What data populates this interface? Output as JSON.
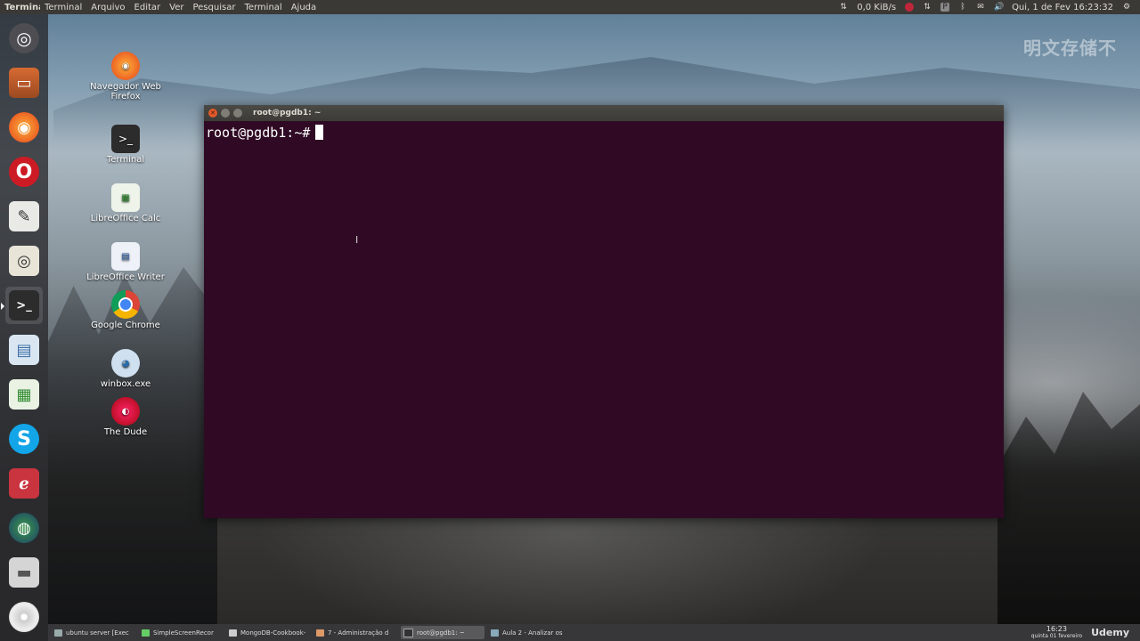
{
  "top_panel": {
    "app_name": "Terminal",
    "menu": [
      "Terminal",
      "Arquivo",
      "Editar",
      "Ver",
      "Pesquisar",
      "Terminal",
      "Ajuda"
    ],
    "net_speed": "0,0 KiB/s",
    "datetime": "Qui, 1 de Fev 16:23:32"
  },
  "watermark": "明文存储不",
  "desktop_icons": [
    {
      "label": "Navegador Web Firefox"
    },
    {
      "label": "Terminal"
    },
    {
      "label": "LibreOffice Calc"
    },
    {
      "label": "LibreOffice Writer"
    },
    {
      "label": "Google Chrome"
    },
    {
      "label": "winbox.exe"
    },
    {
      "label": "The Dude"
    }
  ],
  "terminal": {
    "title": "root@pgdb1: ~",
    "prompt": "root@pgdb1:~#"
  },
  "taskbar": {
    "tasks": [
      "ubuntu server [Exec",
      "SimpleScreenRecor",
      "MongoDB-Cookbook-",
      "7 - Administração d",
      "root@pgdb1: ~",
      "Aula 2 - Analizar os"
    ],
    "clock_time": "16:23",
    "clock_date": "quinta 01 fevereiro",
    "brand": "Udemy"
  },
  "colors": {
    "terminal_bg": "#300a24",
    "panel_bg": "#3a3936",
    "close_button": "#e25a2b"
  }
}
